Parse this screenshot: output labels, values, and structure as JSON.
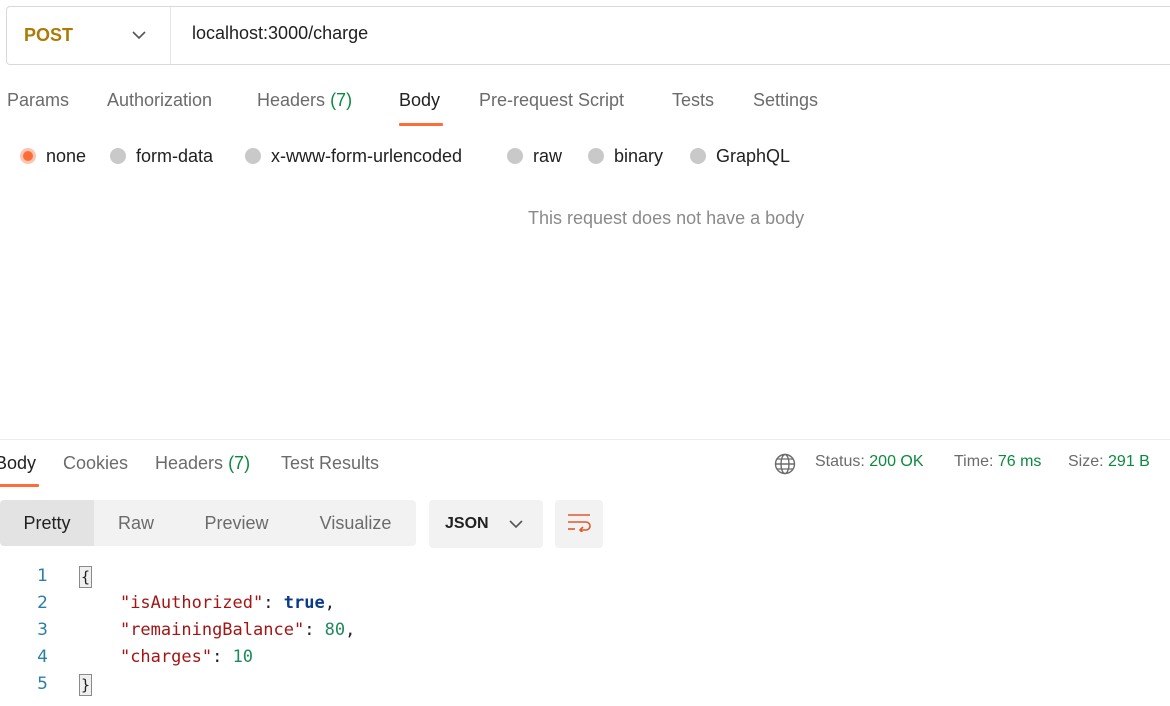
{
  "request": {
    "method": "POST",
    "url": "localhost:3000/charge"
  },
  "request_tabs": [
    {
      "label": "Params"
    },
    {
      "label": "Authorization"
    },
    {
      "label": "Headers",
      "count": "(7)"
    },
    {
      "label": "Body"
    },
    {
      "label": "Pre-request Script"
    },
    {
      "label": "Tests"
    },
    {
      "label": "Settings"
    }
  ],
  "active_request_tab": "Body",
  "body_types": [
    "none",
    "form-data",
    "x-www-form-urlencoded",
    "raw",
    "binary",
    "GraphQL"
  ],
  "selected_body_type": "none",
  "empty_body_message": "This request does not have a body",
  "response_tabs": [
    {
      "label": "Body"
    },
    {
      "label": "Cookies"
    },
    {
      "label": "Headers",
      "count": "(7)"
    },
    {
      "label": "Test Results"
    }
  ],
  "active_response_tab": "Body",
  "response_meta": {
    "status_label": "Status:",
    "status_value": "200 OK",
    "time_label": "Time:",
    "time_value": "76 ms",
    "size_label": "Size:",
    "size_value": "291 B"
  },
  "view_modes": [
    "Pretty",
    "Raw",
    "Preview",
    "Visualize"
  ],
  "active_view_mode": "Pretty",
  "format": "JSON",
  "response_body": {
    "line_numbers": [
      "1",
      "2",
      "3",
      "4",
      "5"
    ],
    "open_brace": "{",
    "close_brace": "}",
    "fields": [
      {
        "key": "\"isAuthorized\"",
        "value": "true",
        "trailing": ","
      },
      {
        "key": "\"remainingBalance\"",
        "value": "80",
        "trailing": ","
      },
      {
        "key": "\"charges\"",
        "value": "10",
        "trailing": ""
      }
    ]
  },
  "colors": {
    "accent": "#ff6c37",
    "method_post": "#ad7a03",
    "success": "#0b8a3e",
    "json_key": "#a31515",
    "json_bool": "#0a3a8c",
    "json_number": "#1f8a5c"
  }
}
